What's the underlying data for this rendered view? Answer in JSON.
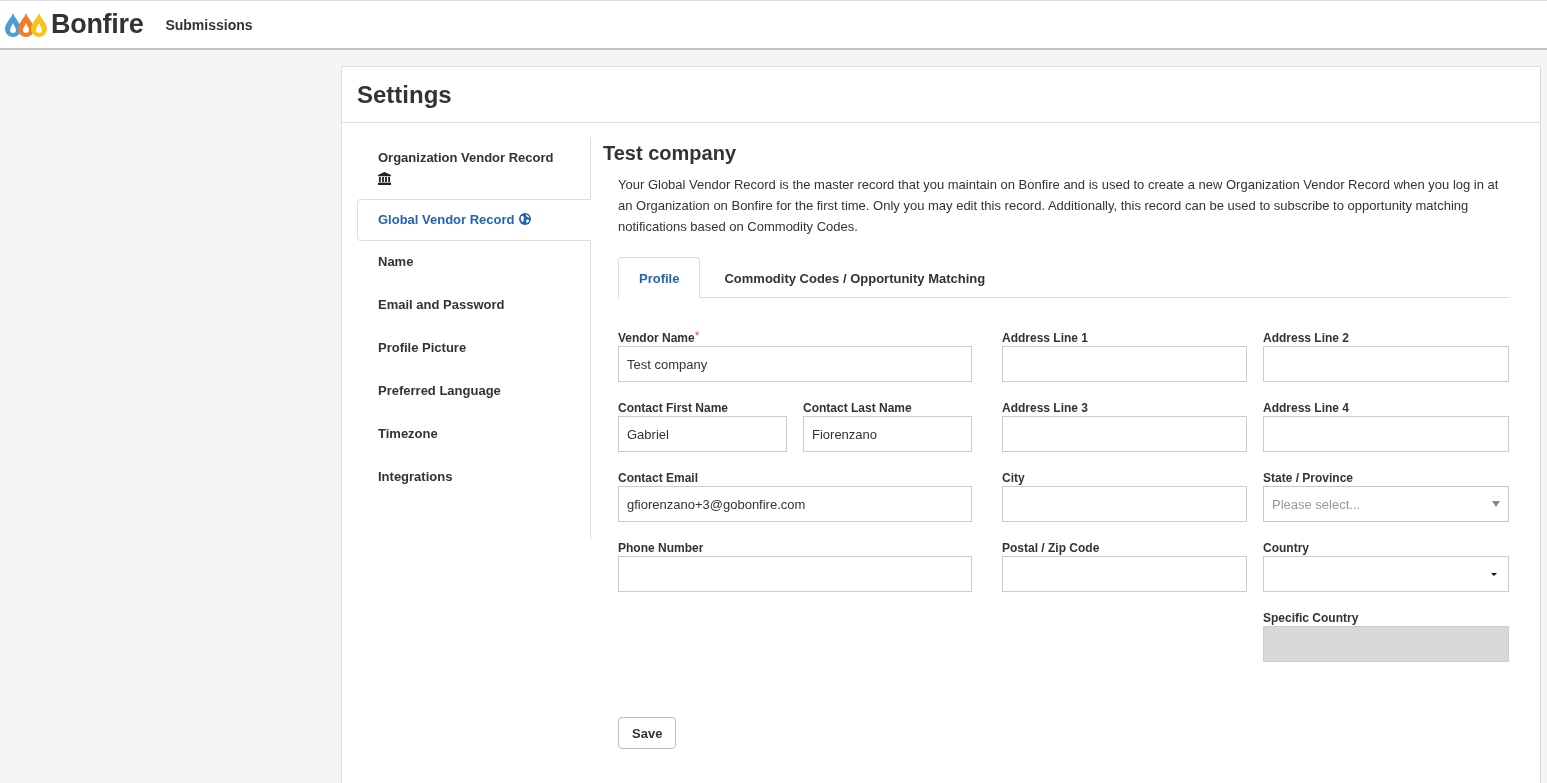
{
  "header": {
    "logo": "Bonfire",
    "nav": [
      {
        "label": "Submissions"
      }
    ]
  },
  "page": {
    "title": "Settings"
  },
  "sidebar": {
    "items": [
      {
        "label": "Organization Vendor Record",
        "kind": "organization",
        "selected": false
      },
      {
        "label": "Global Vendor Record",
        "kind": "global",
        "selected": true
      },
      {
        "label": "Name",
        "kind": "plain",
        "selected": false
      },
      {
        "label": "Email and Password",
        "kind": "plain",
        "selected": false
      },
      {
        "label": "Profile Picture",
        "kind": "plain",
        "selected": false
      },
      {
        "label": "Preferred Language",
        "kind": "plain",
        "selected": false
      },
      {
        "label": "Timezone",
        "kind": "plain",
        "selected": false
      },
      {
        "label": "Integrations",
        "kind": "plain",
        "selected": false
      }
    ]
  },
  "record": {
    "title": "Test company",
    "description": "Your Global Vendor Record is the master record that you maintain on Bonfire and is used to create a new Organization Vendor Record when you log in at an Organization on Bonfire for the first time. Only you may edit this record. Additionally, this record can be used to subscribe to opportunity matching notifications based on Commodity Codes."
  },
  "tabs": [
    {
      "label": "Profile",
      "selected": true
    },
    {
      "label": "Commodity Codes / Opportunity Matching",
      "selected": false
    }
  ],
  "form": {
    "columns": [
      {
        "rows": [
          {
            "fields": [
              {
                "label": "Vendor Name",
                "required_mark": "*",
                "kind": "text",
                "value": "Test company",
                "disabled": false
              }
            ]
          },
          {
            "fields": [
              {
                "label": "Contact First Name",
                "kind": "text",
                "value": "Gabriel",
                "disabled": false
              },
              {
                "label": "Contact Last Name",
                "kind": "text",
                "value": "Fiorenzano",
                "disabled": false
              }
            ]
          },
          {
            "fields": [
              {
                "label": "Contact Email",
                "kind": "text",
                "value": "gfiorenzano+3@gobonfire.com",
                "disabled": false
              }
            ]
          },
          {
            "fields": [
              {
                "label": "Phone Number",
                "kind": "text",
                "disabled": false
              }
            ]
          }
        ]
      },
      {
        "rows": [
          {
            "fields": [
              {
                "label": "Address Line 1",
                "kind": "text",
                "disabled": false
              }
            ]
          },
          {
            "fields": [
              {
                "label": "Address Line 3",
                "kind": "text",
                "disabled": false
              }
            ]
          },
          {
            "fields": [
              {
                "label": "City",
                "kind": "text",
                "disabled": false
              }
            ]
          },
          {
            "fields": [
              {
                "label": "Postal / Zip Code",
                "kind": "text",
                "disabled": false
              }
            ]
          }
        ]
      },
      {
        "rows": [
          {
            "fields": [
              {
                "label": "Address Line 2",
                "kind": "text",
                "disabled": false
              }
            ]
          },
          {
            "fields": [
              {
                "label": "Address Line 4",
                "kind": "text",
                "disabled": false
              }
            ]
          },
          {
            "fields": [
              {
                "label": "State / Province",
                "kind": "combo",
                "placeholder": "Please select...",
                "disabled": false
              }
            ]
          },
          {
            "fields": [
              {
                "label": "Country",
                "kind": "select",
                "disabled": false
              }
            ]
          },
          {
            "fields": [
              {
                "label": "Specific Country",
                "kind": "text",
                "disabled": true
              }
            ]
          }
        ]
      }
    ]
  },
  "save_button": {
    "label": "Save"
  }
}
